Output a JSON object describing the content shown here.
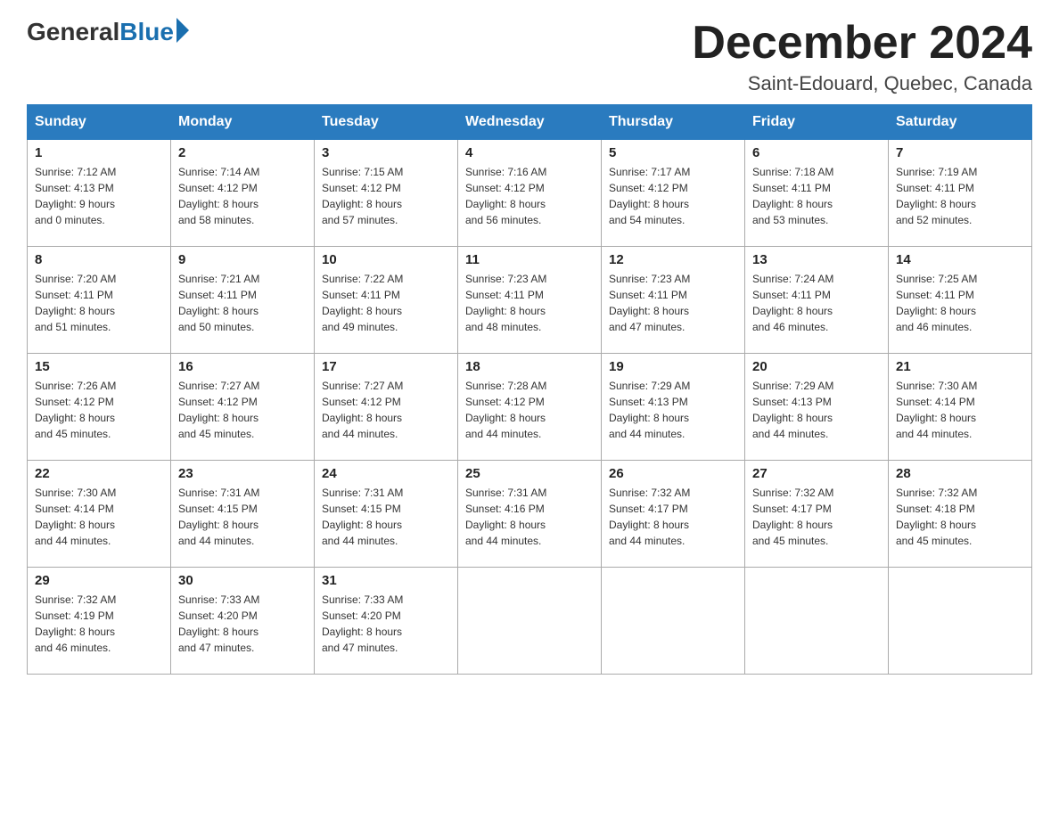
{
  "logo": {
    "general": "General",
    "blue": "Blue"
  },
  "title": "December 2024",
  "location": "Saint-Edouard, Quebec, Canada",
  "days_of_week": [
    "Sunday",
    "Monday",
    "Tuesday",
    "Wednesday",
    "Thursday",
    "Friday",
    "Saturday"
  ],
  "weeks": [
    [
      {
        "day": "1",
        "sunrise": "7:12 AM",
        "sunset": "4:13 PM",
        "daylight": "9 hours and 0 minutes."
      },
      {
        "day": "2",
        "sunrise": "7:14 AM",
        "sunset": "4:12 PM",
        "daylight": "8 hours and 58 minutes."
      },
      {
        "day": "3",
        "sunrise": "7:15 AM",
        "sunset": "4:12 PM",
        "daylight": "8 hours and 57 minutes."
      },
      {
        "day": "4",
        "sunrise": "7:16 AM",
        "sunset": "4:12 PM",
        "daylight": "8 hours and 56 minutes."
      },
      {
        "day": "5",
        "sunrise": "7:17 AM",
        "sunset": "4:12 PM",
        "daylight": "8 hours and 54 minutes."
      },
      {
        "day": "6",
        "sunrise": "7:18 AM",
        "sunset": "4:11 PM",
        "daylight": "8 hours and 53 minutes."
      },
      {
        "day": "7",
        "sunrise": "7:19 AM",
        "sunset": "4:11 PM",
        "daylight": "8 hours and 52 minutes."
      }
    ],
    [
      {
        "day": "8",
        "sunrise": "7:20 AM",
        "sunset": "4:11 PM",
        "daylight": "8 hours and 51 minutes."
      },
      {
        "day": "9",
        "sunrise": "7:21 AM",
        "sunset": "4:11 PM",
        "daylight": "8 hours and 50 minutes."
      },
      {
        "day": "10",
        "sunrise": "7:22 AM",
        "sunset": "4:11 PM",
        "daylight": "8 hours and 49 minutes."
      },
      {
        "day": "11",
        "sunrise": "7:23 AM",
        "sunset": "4:11 PM",
        "daylight": "8 hours and 48 minutes."
      },
      {
        "day": "12",
        "sunrise": "7:23 AM",
        "sunset": "4:11 PM",
        "daylight": "8 hours and 47 minutes."
      },
      {
        "day": "13",
        "sunrise": "7:24 AM",
        "sunset": "4:11 PM",
        "daylight": "8 hours and 46 minutes."
      },
      {
        "day": "14",
        "sunrise": "7:25 AM",
        "sunset": "4:11 PM",
        "daylight": "8 hours and 46 minutes."
      }
    ],
    [
      {
        "day": "15",
        "sunrise": "7:26 AM",
        "sunset": "4:12 PM",
        "daylight": "8 hours and 45 minutes."
      },
      {
        "day": "16",
        "sunrise": "7:27 AM",
        "sunset": "4:12 PM",
        "daylight": "8 hours and 45 minutes."
      },
      {
        "day": "17",
        "sunrise": "7:27 AM",
        "sunset": "4:12 PM",
        "daylight": "8 hours and 44 minutes."
      },
      {
        "day": "18",
        "sunrise": "7:28 AM",
        "sunset": "4:12 PM",
        "daylight": "8 hours and 44 minutes."
      },
      {
        "day": "19",
        "sunrise": "7:29 AM",
        "sunset": "4:13 PM",
        "daylight": "8 hours and 44 minutes."
      },
      {
        "day": "20",
        "sunrise": "7:29 AM",
        "sunset": "4:13 PM",
        "daylight": "8 hours and 44 minutes."
      },
      {
        "day": "21",
        "sunrise": "7:30 AM",
        "sunset": "4:14 PM",
        "daylight": "8 hours and 44 minutes."
      }
    ],
    [
      {
        "day": "22",
        "sunrise": "7:30 AM",
        "sunset": "4:14 PM",
        "daylight": "8 hours and 44 minutes."
      },
      {
        "day": "23",
        "sunrise": "7:31 AM",
        "sunset": "4:15 PM",
        "daylight": "8 hours and 44 minutes."
      },
      {
        "day": "24",
        "sunrise": "7:31 AM",
        "sunset": "4:15 PM",
        "daylight": "8 hours and 44 minutes."
      },
      {
        "day": "25",
        "sunrise": "7:31 AM",
        "sunset": "4:16 PM",
        "daylight": "8 hours and 44 minutes."
      },
      {
        "day": "26",
        "sunrise": "7:32 AM",
        "sunset": "4:17 PM",
        "daylight": "8 hours and 44 minutes."
      },
      {
        "day": "27",
        "sunrise": "7:32 AM",
        "sunset": "4:17 PM",
        "daylight": "8 hours and 45 minutes."
      },
      {
        "day": "28",
        "sunrise": "7:32 AM",
        "sunset": "4:18 PM",
        "daylight": "8 hours and 45 minutes."
      }
    ],
    [
      {
        "day": "29",
        "sunrise": "7:32 AM",
        "sunset": "4:19 PM",
        "daylight": "8 hours and 46 minutes."
      },
      {
        "day": "30",
        "sunrise": "7:33 AM",
        "sunset": "4:20 PM",
        "daylight": "8 hours and 47 minutes."
      },
      {
        "day": "31",
        "sunrise": "7:33 AM",
        "sunset": "4:20 PM",
        "daylight": "8 hours and 47 minutes."
      },
      null,
      null,
      null,
      null
    ]
  ],
  "labels": {
    "sunrise": "Sunrise:",
    "sunset": "Sunset:",
    "daylight": "Daylight:"
  }
}
